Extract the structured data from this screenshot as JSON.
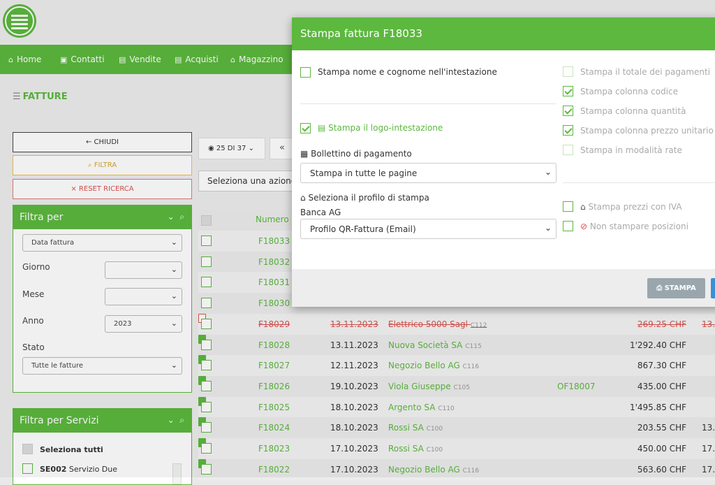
{
  "nav": [
    "Home",
    "Contatti",
    "Vendite",
    "Acquisti",
    "Magazzino"
  ],
  "page_title": "FATTURE",
  "sidebar": {
    "close_label": "← CHIUDI",
    "filter_label": "FILTRA",
    "reset_label": "× RESET RICERCA",
    "filter_panel": {
      "title": "Filtra per",
      "field_select": "Data fattura",
      "day_label": "Giorno",
      "month_label": "Mese",
      "year_label": "Anno",
      "year_value": "2023",
      "status_label": "Stato",
      "status_value": "Tutte le fatture"
    },
    "services_panel": {
      "title": "Filtra per Servizi",
      "select_all": "Seleziona tutti",
      "first_code": "SE002",
      "first_name": "Servizio Due"
    }
  },
  "toolbar": {
    "view_label": "25 DI 37",
    "nav_label": "«",
    "action_select": "Seleziona una azione..."
  },
  "table": {
    "header_number": "Numero",
    "rows": [
      {
        "num": "F18033",
        "date": "",
        "customer": "",
        "code": "",
        "ref": "",
        "amount": "",
        "more": ""
      },
      {
        "num": "F18032",
        "date": "",
        "customer": "",
        "code": "",
        "ref": "",
        "amount": "",
        "more": ""
      },
      {
        "num": "F18031",
        "date": "",
        "customer": "",
        "code": "",
        "ref": "",
        "amount": "",
        "more": ""
      },
      {
        "num": "F18030",
        "date": "",
        "customer": "",
        "code": "",
        "ref": "",
        "amount": "",
        "more": ""
      },
      {
        "num": "F18029",
        "date": "13.11.2023",
        "customer": "Elettrico 5000 Sagl",
        "code": "C112",
        "ref": "",
        "amount": "269.25 CHF",
        "more": "13.",
        "cancelled": true
      },
      {
        "num": "F18028",
        "date": "13.11.2023",
        "customer": "Nuova Società SA",
        "code": "C115",
        "ref": "",
        "amount": "1'292.40 CHF",
        "more": ""
      },
      {
        "num": "F18027",
        "date": "12.11.2023",
        "customer": "Negozio Bello AG",
        "code": "C116",
        "ref": "",
        "amount": "867.30 CHF",
        "more": ""
      },
      {
        "num": "F18026",
        "date": "19.10.2023",
        "customer": "Viola Giuseppe",
        "code": "C105",
        "ref": "OF18007",
        "amount": "435.00 CHF",
        "more": ""
      },
      {
        "num": "F18025",
        "date": "18.10.2023",
        "customer": "Argento SA",
        "code": "C110",
        "ref": "",
        "amount": "1'495.85 CHF",
        "more": ""
      },
      {
        "num": "F18024",
        "date": "18.10.2023",
        "customer": "Rossi SA",
        "code": "C100",
        "ref": "",
        "amount": "203.55 CHF",
        "more": "13."
      },
      {
        "num": "F18023",
        "date": "17.10.2023",
        "customer": "Rossi SA",
        "code": "C100",
        "ref": "",
        "amount": "450.00 CHF",
        "more": "17."
      },
      {
        "num": "F18022",
        "date": "17.10.2023",
        "customer": "Negozio Bello AG",
        "code": "C116",
        "ref": "",
        "amount": "563.60 CHF",
        "more": "17."
      }
    ]
  },
  "modal": {
    "title": "Stampa fattura F18033",
    "opt_name": "Stampa nome e cognome nell'intestazione",
    "opt_logo": "Stampa il logo-intestazione",
    "bollettino_label": "Bollettino di pagamento",
    "bollettino_value": "Stampa in tutte le pagine",
    "profile_label": "Seleziona il profilo di stampa",
    "bank_label": "Banca AG",
    "profile_value": "Profilo QR-Fattura (Email)",
    "opt_total": "Stampa il totale dei pagamenti",
    "opt_code": "Stampa colonna codice",
    "opt_qty": "Stampa colonna quantità",
    "opt_price": "Stampa colonna prezzo unitario",
    "opt_rate": "Stampa in modalità rate",
    "opt_vat": "Stampa prezzi con IVA",
    "opt_nopos": "Non stampare posizioni",
    "print_button": "STAMPA"
  },
  "colors": {
    "accent": "#5cb83e",
    "danger": "#d9534f",
    "warning": "#d9a62e",
    "primary": "#3a8fd6"
  }
}
